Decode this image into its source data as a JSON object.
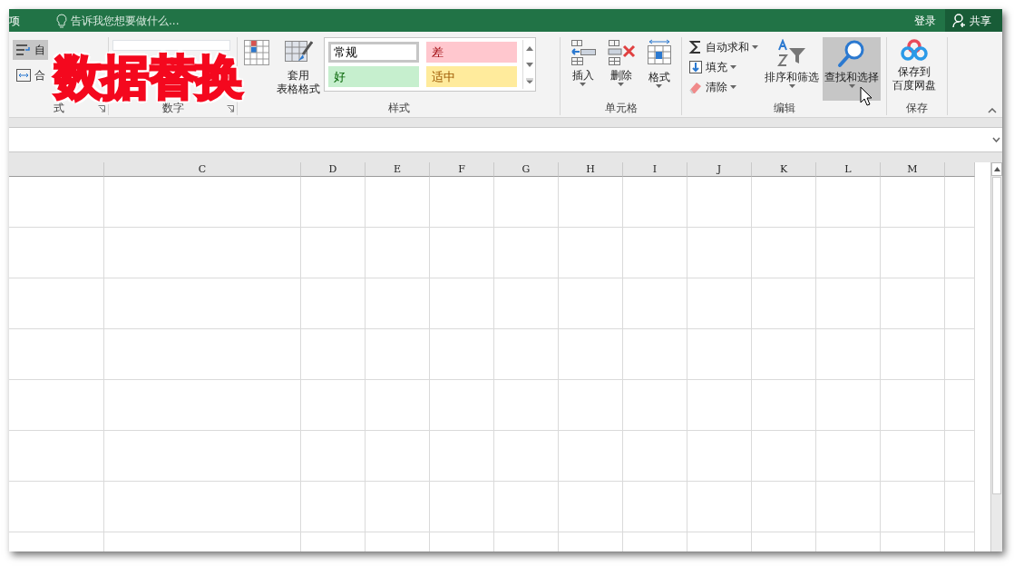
{
  "title_bar": {
    "tab_fragment": "项",
    "tell_me": "告诉我您想要做什么...",
    "sign_in": "登录",
    "share": "共享"
  },
  "ribbon": {
    "groups": [
      {
        "kind": "alignment",
        "label": "式",
        "items": [
          {
            "label": "自",
            "highlighted": true
          },
          {
            "label": "合",
            "highlighted": false
          }
        ]
      },
      {
        "kind": "number",
        "label": "数字"
      },
      {
        "kind": "styles",
        "label": "样式",
        "items": [
          {
            "highlighted": false
          },
          {
            "lines": [
              "套用",
              "表格格式"
            ],
            "highlighted": false
          }
        ],
        "gallery": [
          {
            "label": "常规",
            "selected": true,
            "color": "#ffffff"
          },
          {
            "label": "差",
            "selected": false,
            "color": "#ffc7ce"
          },
          {
            "label": "好",
            "selected": false,
            "color": "#c6efce"
          },
          {
            "label": "适中",
            "selected": false,
            "color": "#ffeb9c"
          }
        ]
      },
      {
        "kind": "cells",
        "label": "单元格",
        "items": [
          {
            "lines": [
              "插入"
            ],
            "highlighted": false
          },
          {
            "lines": [
              "删除"
            ],
            "highlighted": false
          },
          {
            "lines": [
              "格式"
            ],
            "highlighted": false
          }
        ]
      },
      {
        "kind": "editing",
        "label": "编辑",
        "small_items": [
          {
            "label": "自动求和"
          },
          {
            "label": "填充"
          },
          {
            "label": "清除"
          }
        ],
        "items": [
          {
            "lines": [
              "排序和筛选"
            ],
            "highlighted": false
          },
          {
            "lines": [
              "查找和选择"
            ],
            "highlighted": true
          }
        ]
      },
      {
        "kind": "save",
        "label": "保存",
        "items": [
          {
            "lines": [
              "保存到",
              "百度网盘"
            ],
            "highlighted": false
          }
        ]
      }
    ]
  },
  "overlay_caption": "数据替换",
  "sheet": {
    "columns": [
      "",
      "C",
      "D",
      "E",
      "F",
      "G",
      "H",
      "I",
      "J",
      "K",
      "L",
      "M",
      ""
    ]
  }
}
